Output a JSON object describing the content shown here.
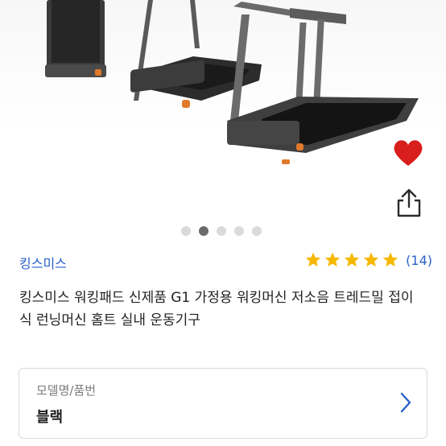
{
  "product": {
    "brand": "킹스미스",
    "rating_count": "(14)",
    "title": "킹스미스 워킹패드 신제품 G1 가정용 워킹머신 저소음 트레드밀 접이식 런닝머신 홈트 실내 운동기구",
    "stars": 5,
    "rating_value": 5
  },
  "carousel": {
    "dot_count": 5,
    "active_index": 1
  },
  "option": {
    "label": "모델명/품번",
    "value": "블랙"
  },
  "icons": {
    "heart": "heart-icon",
    "share": "share-icon",
    "chevron": "chevron-right-icon",
    "star": "star-icon"
  },
  "colors": {
    "accent_blue": "#2a62c9",
    "heart_red": "#d91e1e",
    "star_gold": "#f6b800",
    "dot_active": "#6b6b6b",
    "dot_inactive": "#dadada"
  }
}
